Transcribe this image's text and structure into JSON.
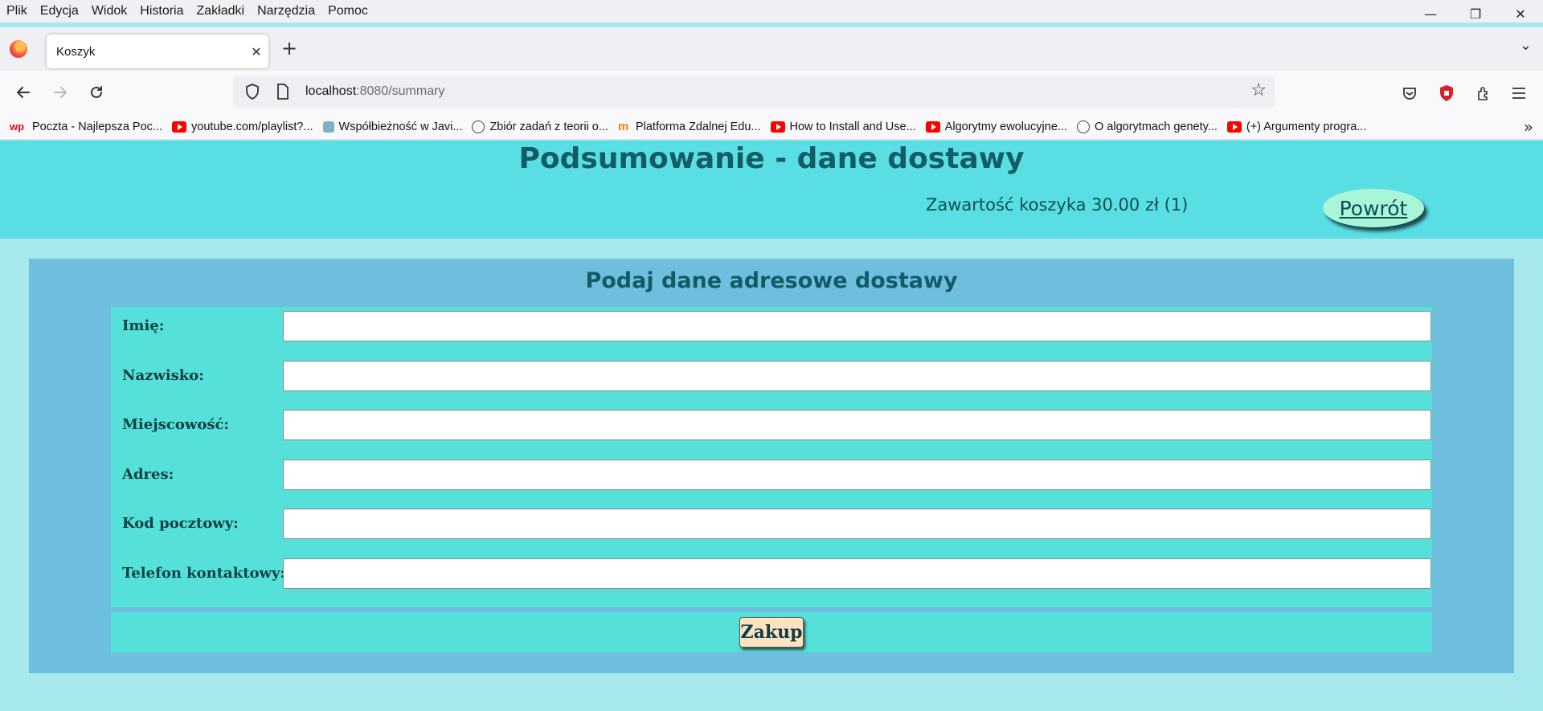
{
  "menubar": {
    "items": [
      "Plik",
      "Edycja",
      "Widok",
      "Historia",
      "Zakładki",
      "Narzędzia",
      "Pomoc"
    ]
  },
  "window_controls": {
    "minimize": "—",
    "restore": "❐",
    "close": "✕"
  },
  "tab": {
    "title": "Koszyk",
    "close": "✕",
    "new_tab": "+",
    "list_all": "⌄"
  },
  "navbar": {
    "url_host": "localhost",
    "url_rest": ":8080/summary"
  },
  "bookmarks": [
    {
      "label": "Poczta - Najlepsza Poc...",
      "icon": "wp-icon"
    },
    {
      "label": "youtube.com/playlist?...",
      "icon": "youtube-icon"
    },
    {
      "label": "Współbieżność w Javi...",
      "icon": "java-icon"
    },
    {
      "label": "Zbiór zadań z teorii o...",
      "icon": "globe-icon"
    },
    {
      "label": "Platforma Zdalnej Edu...",
      "icon": "moodle-icon"
    },
    {
      "label": "How to Install and Use...",
      "icon": "youtube-icon"
    },
    {
      "label": "Algorytmy ewolucyjne...",
      "icon": "youtube-icon"
    },
    {
      "label": "O algorytmach genety...",
      "icon": "globe-icon"
    },
    {
      "label": "(+) Argumenty progra...",
      "icon": "youtube-icon"
    }
  ],
  "page": {
    "title": "Podsumowanie - dane dostawy",
    "cart_info": "Zawartość koszyka 30.00 zł (1)",
    "back_button": "Powrót",
    "form": {
      "title": "Podaj dane adresowe dostawy",
      "fields": [
        {
          "label": "Imię:",
          "value": ""
        },
        {
          "label": "Nazwisko:",
          "value": ""
        },
        {
          "label": "Miejscowość:",
          "value": ""
        },
        {
          "label": "Adres:",
          "value": ""
        },
        {
          "label": "Kod pocztowy:",
          "value": ""
        },
        {
          "label": "Telefon kontaktowy:",
          "value": ""
        }
      ],
      "submit": "Zakup"
    }
  },
  "colors": {
    "header_bg": "#59dfe3",
    "page_bg": "#a6e8ec",
    "panel_bg": "#6ebfde",
    "fields_bg": "#55e1d9",
    "title_color": "#135b66",
    "submit_bg": "#fde3c0",
    "back_bg": "#a8f5d8"
  }
}
